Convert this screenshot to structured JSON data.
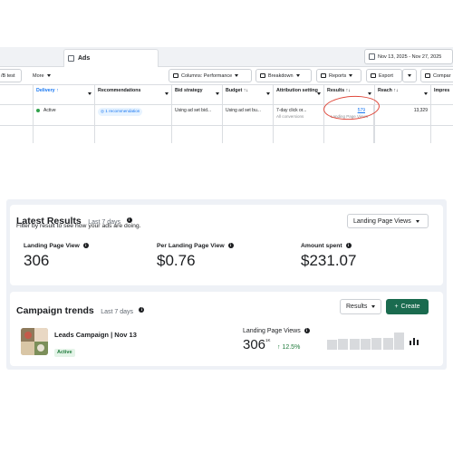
{
  "top": {
    "tab_title": "Ads",
    "date_range": "Nov 13, 2025 - Nov 27, 2025",
    "toolbar": {
      "ab_test": "/B test",
      "more": "More",
      "columns": "Columns: Performance",
      "breakdown": "Breakdown",
      "reports": "Reports",
      "export": "Export",
      "compare": "Compar"
    },
    "columns": {
      "delivery": "Delivery ↑",
      "recommendations": "Recommendations",
      "bid_strategy": "Bid strategy",
      "budget": "Budget ↑↓",
      "attribution": "Attribution setting",
      "results": "Results ↑↓",
      "reach": "Reach ↑↓",
      "impressions": "Impres"
    },
    "row": {
      "delivery": "Active",
      "recommendations": "1 recommendation",
      "bid_strategy": "Using ad set bid...",
      "budget": "Using ad set bu...",
      "attribution": "7-day click or...",
      "attribution_sub": "All conversions",
      "results": "579",
      "results_sub": "Landing Page Views",
      "reach": "13,329"
    }
  },
  "latest": {
    "title": "Latest Results",
    "period": "Last 7 days",
    "subtitle": "Filter by result to see how your ads are doing.",
    "filter": "Landing Page Views",
    "metrics": [
      {
        "label": "Landing Page View",
        "value": "306"
      },
      {
        "label": "Per Landing Page View",
        "value": "$0.76"
      },
      {
        "label": "Amount spent",
        "value": "$231.07"
      }
    ]
  },
  "trends": {
    "title": "Campaign trends",
    "period": "Last 7 days",
    "results_select": "Results",
    "create": "Create",
    "campaign_name": "Leads Campaign | Nov 13",
    "status": "Active",
    "metric_label": "Landing Page Views",
    "metric_value": "306",
    "metric_sup": "1K",
    "change": "12.5%",
    "bars": [
      0.55,
      0.58,
      0.62,
      0.6,
      0.63,
      0.66,
      0.95
    ]
  },
  "colors": {
    "accent_green": "#1a6b4f",
    "active_green": "#31a24c",
    "link_blue": "#1877f2",
    "annotation_red": "#e04a3d",
    "panel_bg": "#eef1f6"
  }
}
